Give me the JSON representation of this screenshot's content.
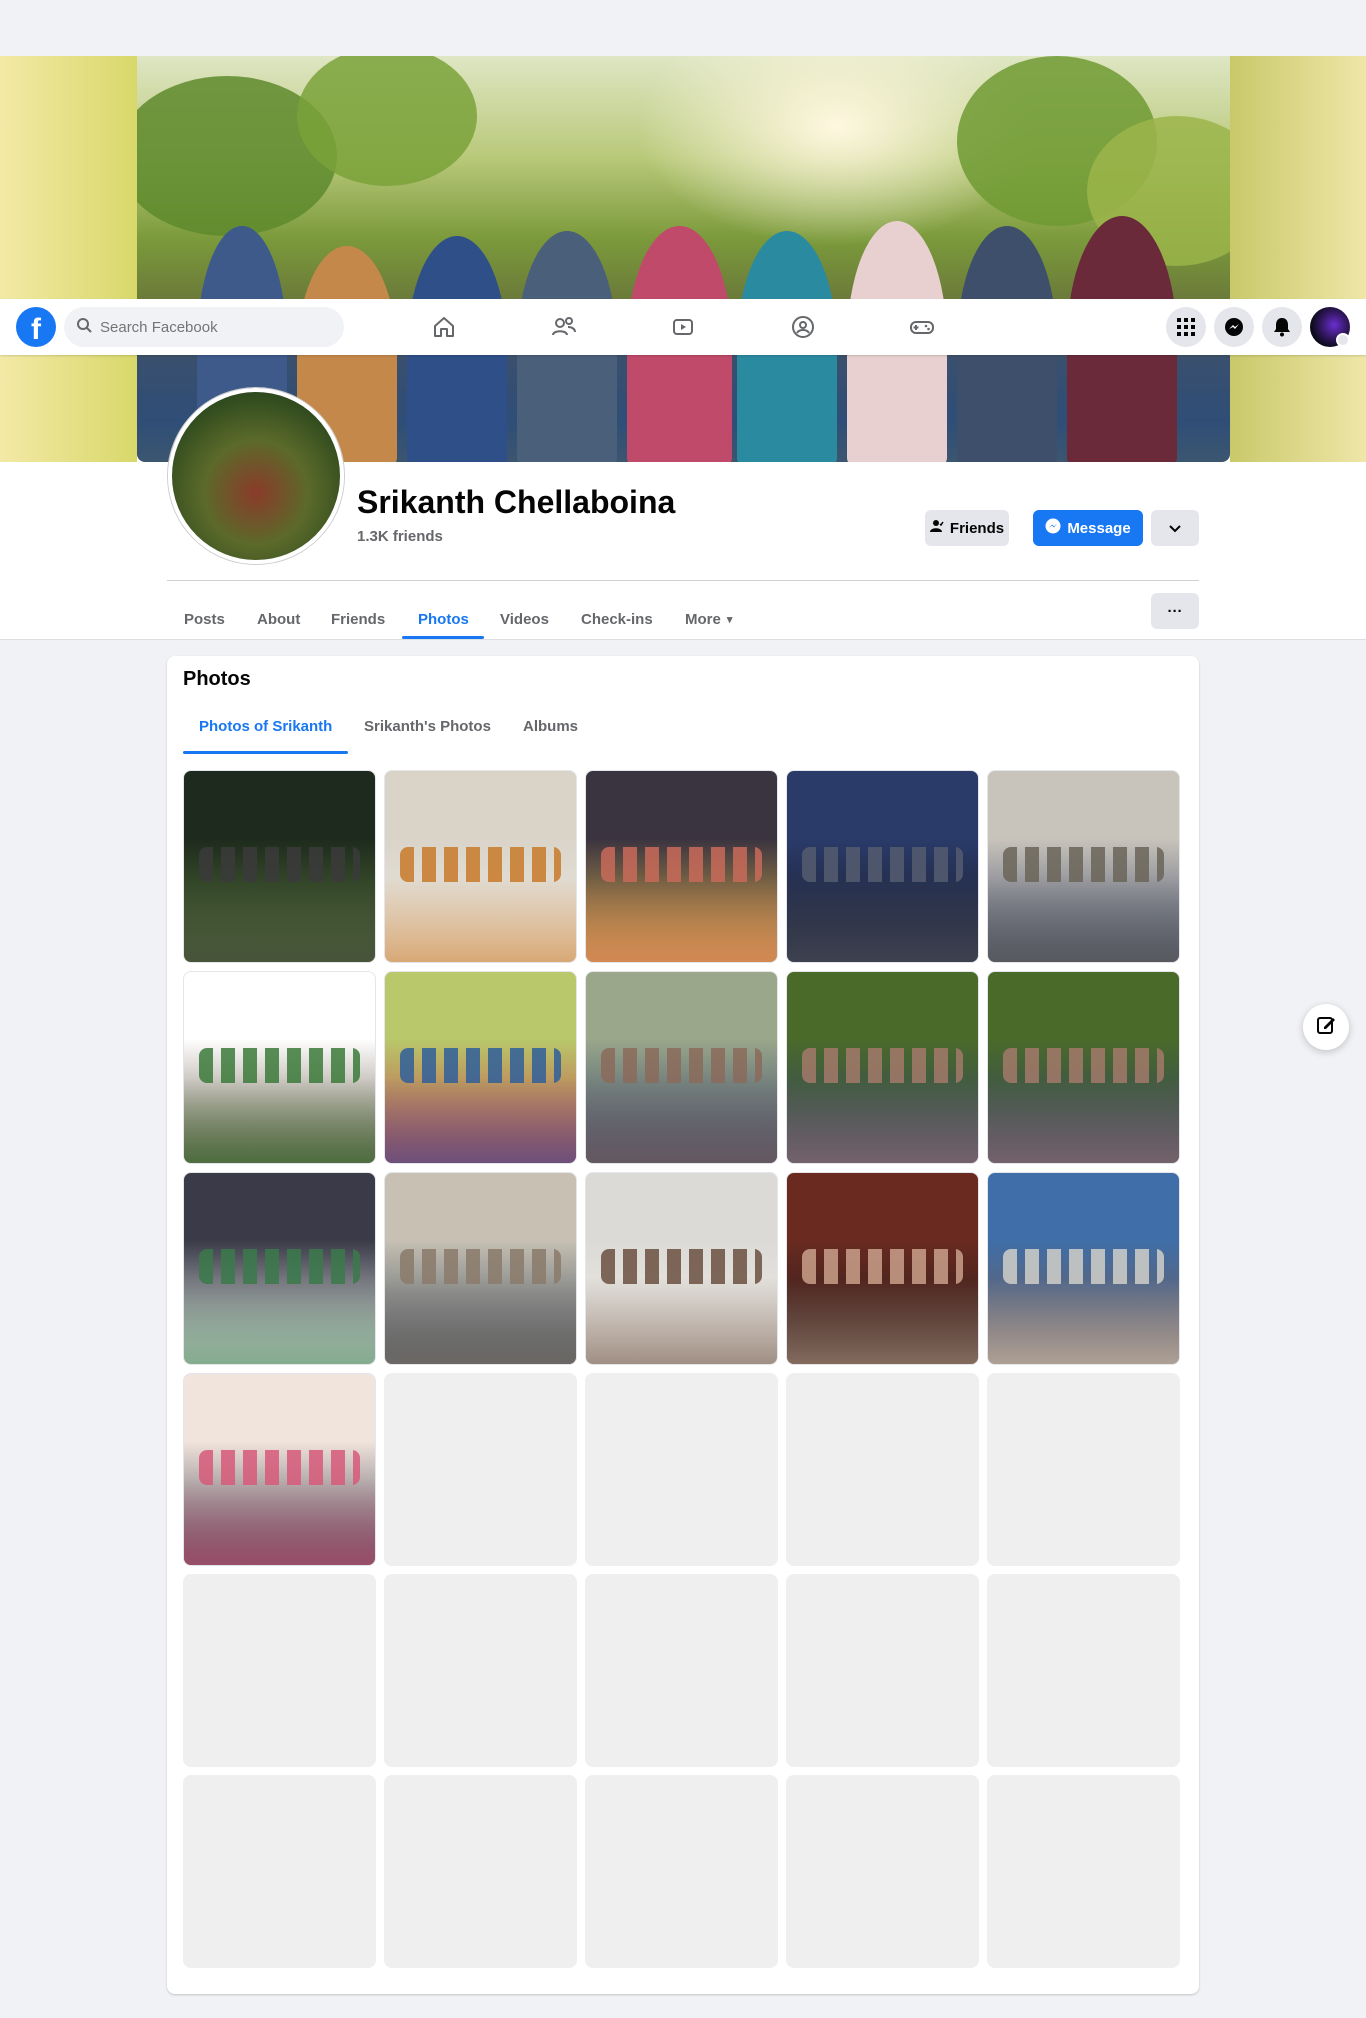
{
  "topbar": {
    "search_placeholder": "Search Facebook",
    "logo_letter": "f",
    "icons": [
      "home-icon",
      "friends-icon",
      "watch-icon",
      "groups-icon",
      "gaming-icon"
    ],
    "right_icons": [
      "menu-grid-icon",
      "messenger-icon",
      "notifications-icon"
    ]
  },
  "profile": {
    "name": "Srikanth Chellaboina",
    "friend_count": "1.3K friends",
    "friends_button": "Friends",
    "message_button": "Message"
  },
  "profile_tabs": [
    {
      "label": "Posts",
      "active": false
    },
    {
      "label": "About",
      "active": false
    },
    {
      "label": "Friends",
      "active": false
    },
    {
      "label": "Photos",
      "active": true
    },
    {
      "label": "Videos",
      "active": false
    },
    {
      "label": "Check-ins",
      "active": false
    },
    {
      "label": "More",
      "active": false
    }
  ],
  "more_tab_suffix": "▾",
  "more_options_label": "···",
  "photos": {
    "title": "Photos",
    "subtabs": [
      {
        "label": "Photos of Srikanth",
        "active": true
      },
      {
        "label": "Srikanth's Photos",
        "active": false
      },
      {
        "label": "Albums",
        "active": false
      }
    ],
    "loaded_count": 16,
    "placeholder_count": 14
  },
  "colors": {
    "accent": "#1877f2",
    "background": "#f0f2f5",
    "secondary_text": "#65676b"
  }
}
